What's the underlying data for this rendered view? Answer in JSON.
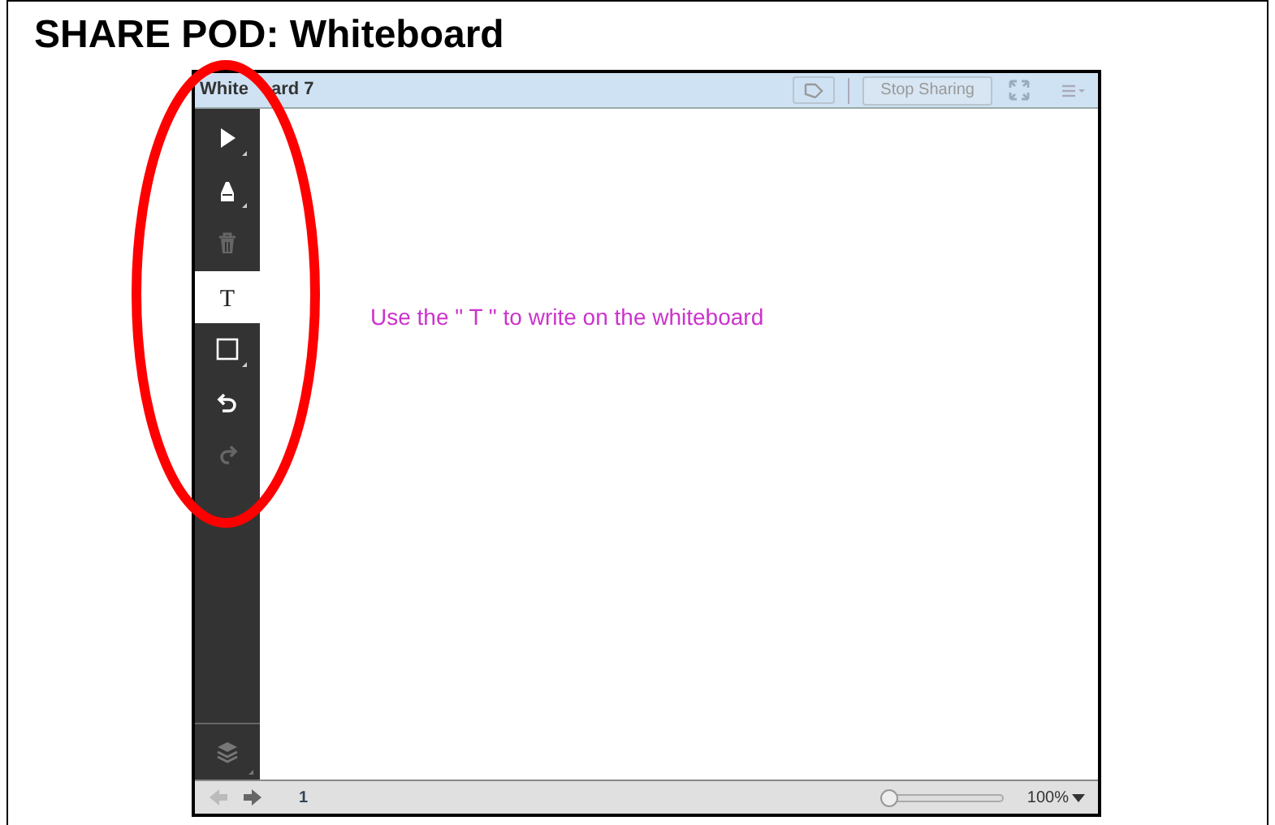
{
  "heading": "SHARE POD: Whiteboard",
  "pod": {
    "title_fragments": [
      "White",
      "ard 7"
    ],
    "stop_sharing": "Stop Sharing",
    "tools": [
      {
        "kind": "pointer",
        "selected": false,
        "disabled": false,
        "has_menu": true
      },
      {
        "kind": "marker",
        "selected": false,
        "disabled": false,
        "has_menu": true
      },
      {
        "kind": "trash",
        "selected": false,
        "disabled": true,
        "has_menu": false
      },
      {
        "kind": "text",
        "glyph": "T",
        "selected": true,
        "disabled": false,
        "has_menu": false
      },
      {
        "kind": "rectangle",
        "selected": false,
        "disabled": false,
        "has_menu": true
      },
      {
        "kind": "undo",
        "selected": false,
        "disabled": false,
        "has_menu": false
      },
      {
        "kind": "redo",
        "selected": false,
        "disabled": true,
        "has_menu": false
      }
    ],
    "canvas_text": "Use the \" T \" to write on the whiteboard",
    "nav": [
      {
        "kind": "prev",
        "disabled": true
      },
      {
        "kind": "next",
        "disabled": false
      }
    ],
    "page_number": "1",
    "zoom": {
      "level": 0,
      "label": "100%"
    }
  }
}
